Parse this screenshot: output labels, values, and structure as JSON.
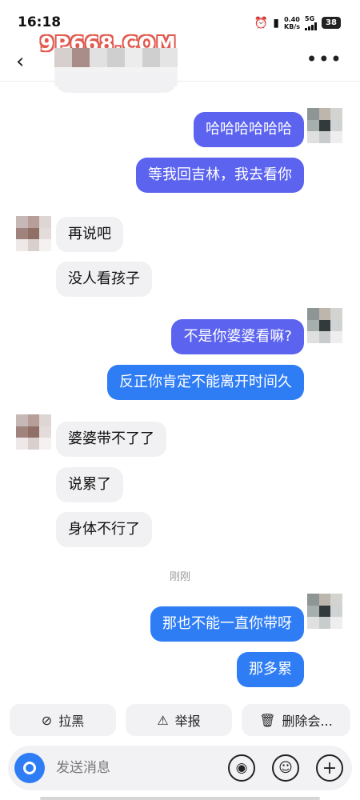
{
  "status_bar": {
    "time": "16:18",
    "net_speed": "0.40",
    "net_speed_unit": "KB/s",
    "network": "5G",
    "battery": "38"
  },
  "watermark": "9P668.COM",
  "header": {
    "back_icon": "chevron-left-icon",
    "more_icon": "more-horizontal-icon"
  },
  "messages": [
    {
      "side": "out",
      "text": "哈哈哈哈哈哈"
    },
    {
      "side": "out",
      "text": "等我回吉林，我去看你"
    },
    {
      "side": "in",
      "text": "再说吧"
    },
    {
      "side": "in",
      "text": "没人看孩子"
    },
    {
      "side": "out",
      "text": "不是你婆婆看嘛?"
    },
    {
      "side": "out",
      "text": "反正你肯定不能离开时间久"
    },
    {
      "side": "in",
      "text": "婆婆带不了了"
    },
    {
      "side": "in",
      "text": "说累了"
    },
    {
      "side": "in",
      "text": "身体不行了"
    },
    {
      "side": "out",
      "text": "那也不能一直你带呀"
    },
    {
      "side": "out",
      "text": "那多累"
    }
  ],
  "timestamp": "刚刚",
  "actions": {
    "block": "拉黑",
    "report": "举报",
    "delete": "删除会..."
  },
  "input": {
    "placeholder": "发送消息",
    "icons": [
      "camera-icon",
      "voice-icon",
      "emoji-icon",
      "add-icon"
    ]
  },
  "colors": {
    "bubble_out_purple": "#5b63ef",
    "bubble_out_blue": "#2f7df5",
    "bubble_in": "#f1f1f3"
  }
}
